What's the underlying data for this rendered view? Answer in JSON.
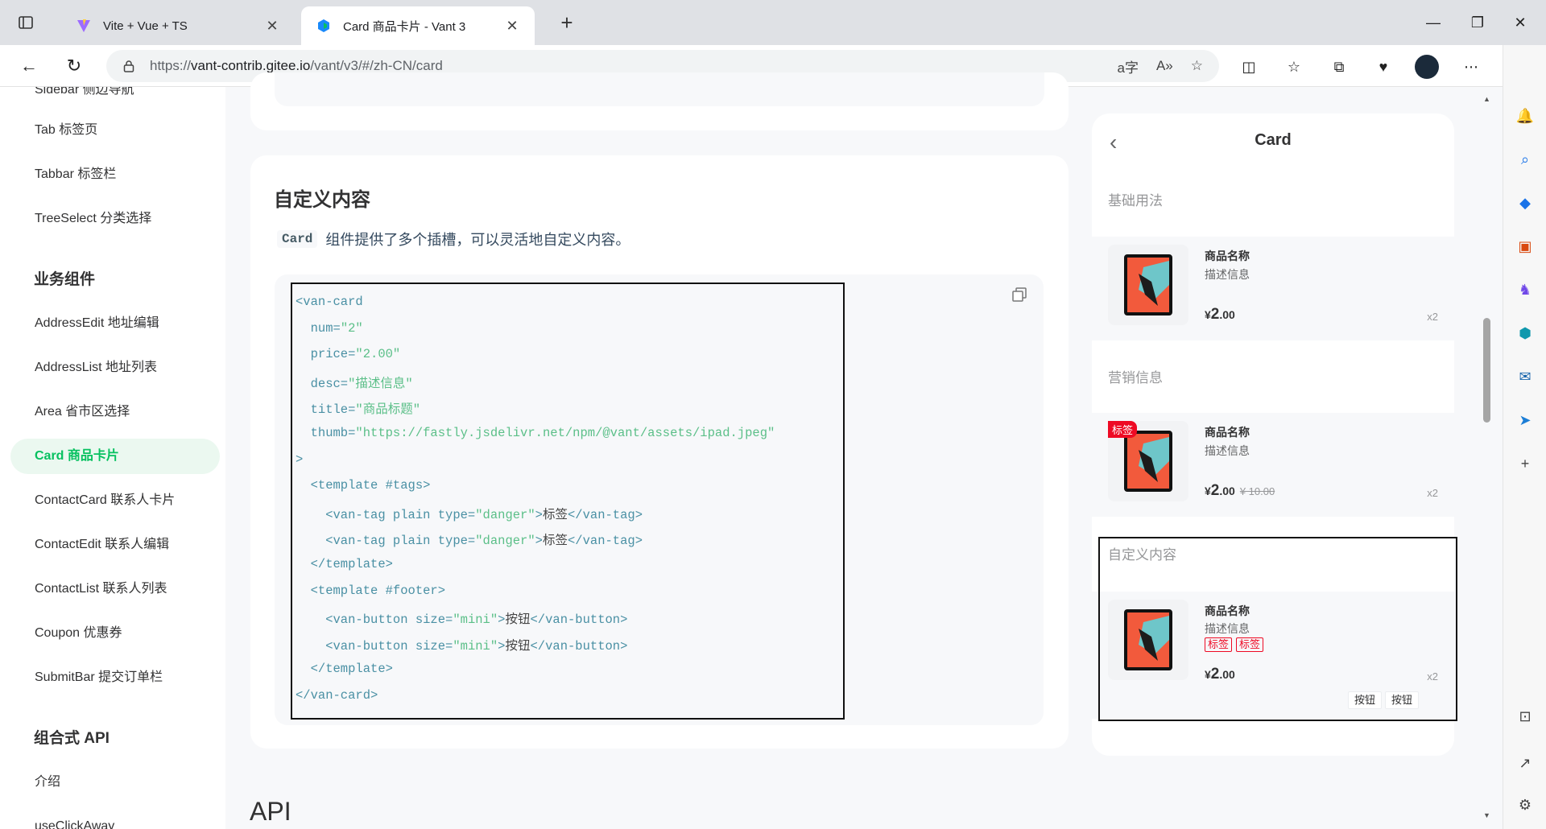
{
  "browser": {
    "tabs": [
      {
        "title": "Vite + Vue + TS",
        "active": false
      },
      {
        "title": "Card 商品卡片 - Vant 3",
        "active": true
      }
    ],
    "url_prefix": "https://",
    "url_host": "vant-contrib.gitee.io",
    "url_path": "/vant/v3/#/zh-CN/card",
    "new_tab": "+",
    "close_glyph": "✕"
  },
  "docnav": {
    "partial_top_item": "Sidebar 侧边导航",
    "items_top": [
      "Tab 标签页",
      "Tabbar 标签栏",
      "TreeSelect 分类选择"
    ],
    "group_business": "业务组件",
    "items_business": [
      "AddressEdit 地址编辑",
      "AddressList 地址列表",
      "Area 省市区选择",
      "Card 商品卡片",
      "ContactCard 联系人卡片",
      "ContactEdit 联系人编辑",
      "ContactList 联系人列表",
      "Coupon 优惠券",
      "SubmitBar 提交订单栏"
    ],
    "active_item": "Card 商品卡片",
    "group_api": "组合式 API",
    "items_api": [
      "介绍",
      "useClickAway"
    ]
  },
  "main": {
    "section_title": "自定义内容",
    "desc_code": "Card",
    "desc_text": "组件提供了多个插槽，可以灵活地自定义内容。",
    "api_title": "API",
    "code_lines": [
      "<van-card",
      "  num=\"2\"",
      "  price=\"2.00\"",
      "  desc=\"描述信息\"",
      "  title=\"商品标题\"",
      "  thumb=\"https://fastly.jsdelivr.net/npm/@vant/assets/ipad.jpeg\"",
      ">",
      "  <template #tags>",
      "    <van-tag plain type=\"danger\">标签</van-tag>",
      "    <van-tag plain type=\"danger\">标签</van-tag>",
      "  </template>",
      "  <template #footer>",
      "    <van-button size=\"mini\">按钮</van-button>",
      "    <van-button size=\"mini\">按钮</van-button>",
      "  </template>",
      "</van-card>"
    ]
  },
  "simulator": {
    "back_glyph": "‹",
    "title": "Card",
    "demos": [
      {
        "title": "基础用法",
        "name": "商品名称",
        "desc": "描述信息",
        "currency": "¥",
        "price_int": "2",
        "price_dec": ".00",
        "num": "x2"
      },
      {
        "title": "营销信息",
        "name": "商品名称",
        "desc": "描述信息",
        "tag": "标签",
        "currency": "¥",
        "price_int": "2",
        "price_dec": ".00",
        "origin_price": "¥ 10.00",
        "num": "x2"
      },
      {
        "title": "自定义内容",
        "name": "商品名称",
        "desc": "描述信息",
        "tags": [
          "标签",
          "标签"
        ],
        "currency": "¥",
        "price_int": "2",
        "price_dec": ".00",
        "num": "x2",
        "buttons": [
          "按钮",
          "按钮"
        ]
      }
    ]
  },
  "colors": {
    "brand_green": "#07c160",
    "danger_red": "#ee0a24",
    "page_bg": "#f7f8fa"
  }
}
